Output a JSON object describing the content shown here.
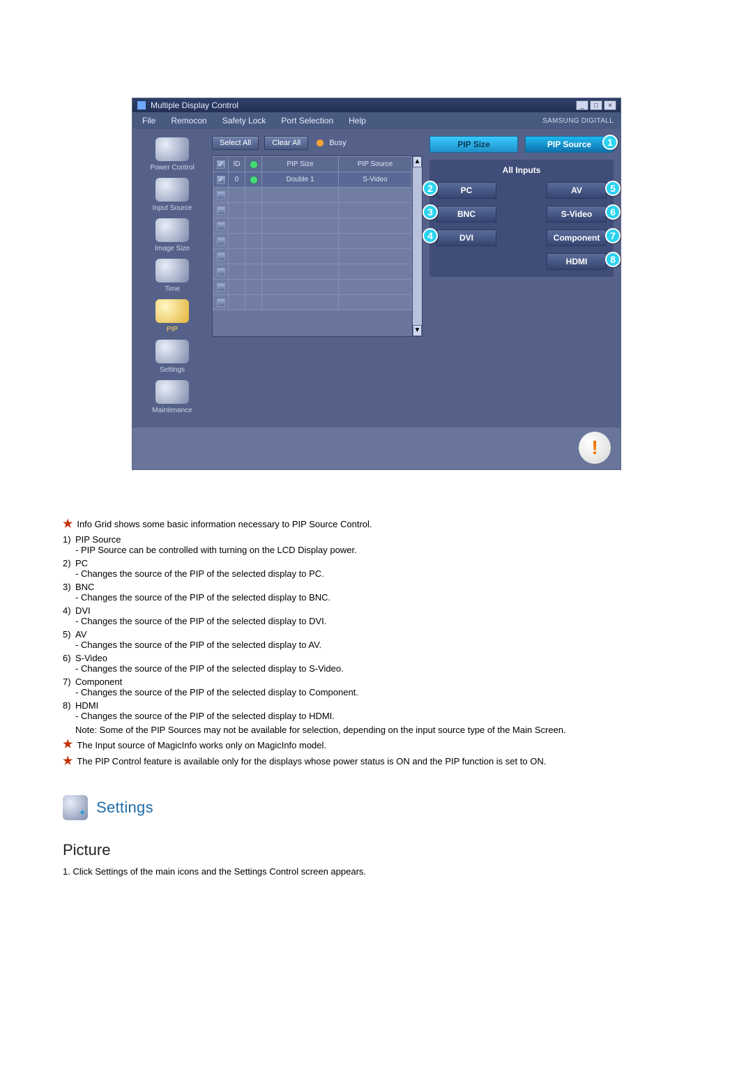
{
  "app": {
    "title": "Multiple Display Control",
    "brand": "SAMSUNG DIGITALL",
    "menu": [
      "File",
      "Remocon",
      "Safety Lock",
      "Port Selection",
      "Help"
    ],
    "sidebar": [
      {
        "label": "Power Control"
      },
      {
        "label": "Input Source"
      },
      {
        "label": "Image Size"
      },
      {
        "label": "Time"
      },
      {
        "label": "PIP",
        "active": true
      },
      {
        "label": "Settings"
      },
      {
        "label": "Maintenance"
      }
    ],
    "toolbar": {
      "select_all": "Select All",
      "clear_all": "Clear All",
      "busy": "Busy"
    },
    "grid": {
      "headers": {
        "id": "ID",
        "pip_size": "PIP Size",
        "pip_source": "PIP Source"
      },
      "row0": {
        "id": "0",
        "pip_size": "Double 1",
        "pip_source": "S-Video"
      }
    },
    "tabs": {
      "pip_size": "PIP Size",
      "pip_source": "PIP Source"
    },
    "panel_title": "All Inputs",
    "options": {
      "pc": "PC",
      "av": "AV",
      "bnc": "BNC",
      "svideo": "S-Video",
      "dvi": "DVI",
      "component": "Component",
      "hdmi": "HDMI"
    },
    "callouts": {
      "c1": "1",
      "c2": "2",
      "c3": "3",
      "c4": "4",
      "c5": "5",
      "c6": "6",
      "c7": "7",
      "c8": "8"
    },
    "footer_alert": "!"
  },
  "doc": {
    "intro": "Info Grid shows some basic information necessary to PIP Source Control.",
    "items": [
      {
        "n": "1)",
        "title": "PIP Source",
        "desc": "- PIP Source can be controlled with turning on the LCD Display power."
      },
      {
        "n": "2)",
        "title": "PC",
        "desc": "- Changes the source of the PIP of the selected display to PC."
      },
      {
        "n": "3)",
        "title": "BNC",
        "desc": "- Changes the source of the PIP of the selected display to BNC."
      },
      {
        "n": "4)",
        "title": "DVI",
        "desc": "- Changes the source of the PIP of the selected display to DVI."
      },
      {
        "n": "5)",
        "title": "AV",
        "desc": "- Changes the source of the PIP of the selected display to AV."
      },
      {
        "n": "6)",
        "title": "S-Video",
        "desc": "- Changes the source of the PIP of the selected display to S-Video."
      },
      {
        "n": "7)",
        "title": "Component",
        "desc": "- Changes the source of the PIP of the selected display to Component."
      },
      {
        "n": "8)",
        "title": "HDMI",
        "desc": "- Changes the source of the PIP of the selected display to HDMI."
      }
    ],
    "note": "Note: Some of the PIP Sources may not be available for selection, depending on the input source type of the Main Screen.",
    "star2": "The Input source of MagicInfo works only on MagicInfo model.",
    "star3": "The PIP Control feature is available only for the displays whose power status is ON and the PIP function is set to ON.",
    "settings_heading": "Settings",
    "picture_heading": "Picture",
    "picture_step": "1.  Click Settings of the main icons and the Settings Control screen appears."
  }
}
